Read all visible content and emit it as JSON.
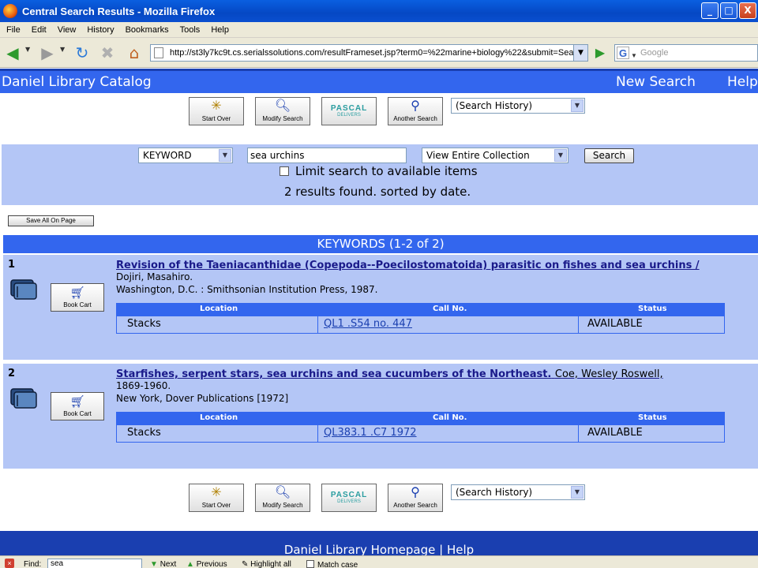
{
  "window": {
    "title": "Central Search Results - Mozilla Firefox",
    "minimize": "_",
    "maximize": "□",
    "close": "X"
  },
  "menu": [
    "File",
    "Edit",
    "View",
    "History",
    "Bookmarks",
    "Tools",
    "Help"
  ],
  "nav": {
    "url": "http://st3ly7kc9t.cs.serialssolutions.com/resultFrameset.jsp?term0=%22marine+biology%22&submit=Searc",
    "search_placeholder": "Google",
    "search_engine_glyph": "G"
  },
  "header": {
    "library_name": "Daniel Library Catalog",
    "new_search": "New Search",
    "help": "Help"
  },
  "toolbar": {
    "start_over": "Start Over",
    "modify_search": "Modify Search",
    "pascal": "PASCAL",
    "pascal_sub": "DELIVERS",
    "another_search": "Another Search",
    "history_select": "(Search History)"
  },
  "search": {
    "field_select": "KEYWORD",
    "query": "sea urchins",
    "collection_select": "View Entire Collection",
    "search_button": "Search",
    "limit_label": "Limit search to available items",
    "results_summary": "2 results found. sorted by date."
  },
  "save_all_label": "Save All On Page",
  "results_header": "KEYWORDS (1-2 of 2)",
  "book_cart_label": "Book Cart",
  "holdings_columns": {
    "location": "Location",
    "call_no": "Call No.",
    "status": "Status"
  },
  "records": [
    {
      "number": "1",
      "title": "Revision of the Taeniacanthidae (Copepoda--Poecilostomatoida) parasitic on fishes and sea urchins /",
      "author": "Dojiri, Masahiro.",
      "publication": "Washington, D.C. : Smithsonian Institution Press, 1987.",
      "location": "Stacks",
      "call_no": "QL1 .S54 no. 447",
      "status": "AVAILABLE"
    },
    {
      "number": "2",
      "title": "Starfishes, serpent stars, sea urchins and sea cucumbers of the Northeast.",
      "author_inline": "Coe, Wesley Roswell,",
      "author_dates": "1869-1960.",
      "publication": "New York, Dover Publications [1972]",
      "location": "Stacks",
      "call_no": "QL383.1 .C7 1972",
      "status": "AVAILABLE"
    }
  ],
  "footer": {
    "text": "Daniel Library Homepage | Help"
  },
  "findbar": {
    "label": "Find:",
    "value": "sea",
    "next": "Next",
    "previous": "Previous",
    "highlight": "Highlight all",
    "match_case": "Match case"
  }
}
